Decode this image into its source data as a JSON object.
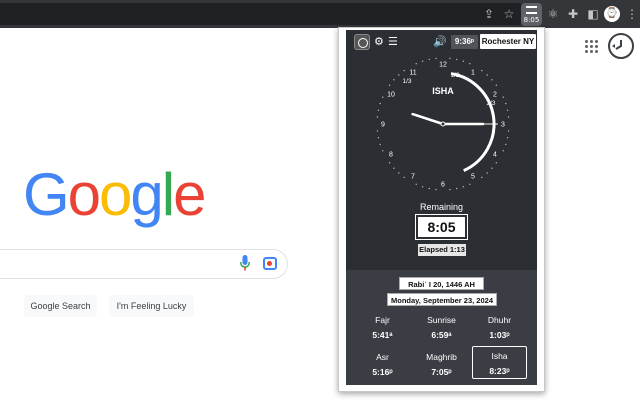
{
  "browser": {
    "extension_badge": "8:05",
    "avatar_glyph": "⌚"
  },
  "google": {
    "logo_letters": [
      "G",
      "o",
      "o",
      "g",
      "l",
      "e"
    ],
    "search_button": "Google Search",
    "lucky_button": "I'm Feeling Lucky"
  },
  "popup": {
    "current_time": "9:36ᵖ",
    "location": "Rochester NY",
    "clock": {
      "prayer_name": "ISHA",
      "numerals": [
        "12",
        "1",
        "2",
        "3",
        "4",
        "5",
        "6",
        "7",
        "8",
        "9",
        "10",
        "11"
      ],
      "fractions": [
        "1/3",
        "1/2",
        "2/3"
      ],
      "hour_hand_hours": 9.6,
      "minute_hand_minutes": 15,
      "seconds_hand_minutes": 36,
      "arc_start_hour": 12.3,
      "arc_end_hour": 5.2
    },
    "remaining_label": "Remaining",
    "remaining_value": "8:05",
    "elapsed_label": "Elapsed",
    "elapsed_value": "1:13",
    "hijri_date": "Rabiʿ I 20, 1446 AH",
    "gregorian_date": "Monday, September 23, 2024",
    "prayers": [
      {
        "name": "Fajr",
        "time": "5:41ᵃ"
      },
      {
        "name": "Sunrise",
        "time": "6:59ᵃ"
      },
      {
        "name": "Dhuhr",
        "time": "1:03ᵖ"
      },
      {
        "name": "Asr",
        "time": "5:16ᵖ"
      },
      {
        "name": "Maghrib",
        "time": "7:05ᵖ"
      },
      {
        "name": "Isha",
        "time": "8:23ᵖ",
        "active": true
      }
    ]
  },
  "colors": {
    "panel_dark": "#2b2e33",
    "panel_bottom": "#3a3d43",
    "google_blue": "#4285f4",
    "google_red": "#ea4335",
    "google_yellow": "#fbbc05",
    "google_green": "#34a853"
  }
}
